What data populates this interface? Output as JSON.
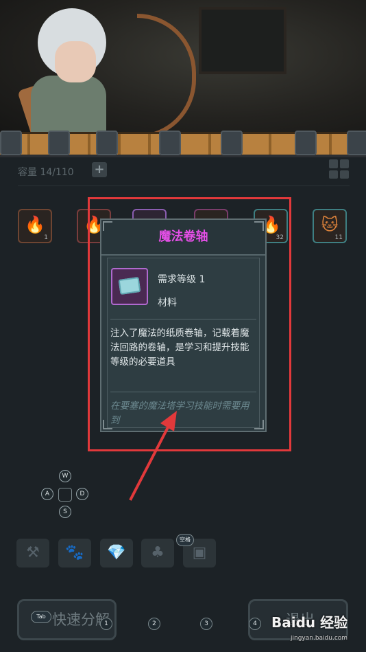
{
  "inventory": {
    "capacity_label": "容量 14/110",
    "add_label": "+",
    "slots": [
      {
        "glyph": "🔥",
        "count": "1"
      },
      {
        "glyph": "🔥",
        "count": ""
      },
      {
        "glyph": "",
        "count": ""
      },
      {
        "glyph": "",
        "count": ""
      },
      {
        "glyph": "🔥",
        "count": "32"
      },
      {
        "glyph": "🐱",
        "count": "11"
      }
    ]
  },
  "tooltip": {
    "title": "魔法卷轴",
    "required_level": "需求等级 1",
    "item_type": "材料",
    "description": "注入了魔法的纸质卷轴，记载着魔法回路的卷轴，是学习和提升技能等级的必要道具",
    "hint": "在要塞的魔法塔学习技能时需要用到",
    "title_color": "#e54fe7",
    "highlight_color": "#e2393b"
  },
  "dpad": {
    "up": "W",
    "left": "A",
    "right": "D",
    "down": "S"
  },
  "toolbar": {
    "items": [
      {
        "icon": "hammer-icon",
        "glyph": "⚒"
      },
      {
        "icon": "paw-icon",
        "glyph": "🐾"
      },
      {
        "icon": "gem-icon",
        "glyph": "💎"
      },
      {
        "icon": "bag-icon",
        "glyph": "♣"
      },
      {
        "icon": "chest-icon",
        "glyph": "▣"
      }
    ],
    "space_key_label": "空格"
  },
  "bottom": {
    "decompose_label": "快速分解",
    "exit_label": "退出",
    "tab_key_label": "Tab",
    "hotkeys": [
      "1",
      "2",
      "3",
      "4"
    ]
  },
  "watermark": {
    "brand": "Baidu 经验",
    "url": "jingyan.baidu.com"
  }
}
